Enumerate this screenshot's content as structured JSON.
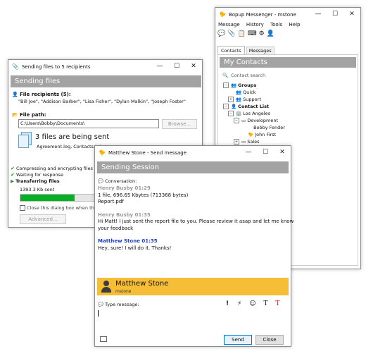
{
  "sending_window": {
    "title": "Sending files to 5 recipients",
    "banner": "Sending files",
    "recipients_label": "File recipients (5):",
    "recipients_list": "\"Bill Joe\", \"Addison Barber\", \"Lisa Fisher\", \"Dylan Malkin\", \"Joseph Foster\"",
    "file_path_label": "File path:",
    "file_path_value": "C:\\Users\\Bobby\\Documents\\",
    "browse_label": "Browse...",
    "files_sending_title": "3 files are being sent",
    "files_list": "Agreement.log, Contacts.txt,",
    "steps": [
      {
        "label": "Compressing and encrypting files"
      },
      {
        "label": "Waiting for response"
      },
      {
        "label": "Transferring files"
      }
    ],
    "progress_text": "1393.3 Kb sent",
    "progress_fraction": 0.62,
    "close_checkbox_label": "Close this dialog box when the tran",
    "advanced_label": "Advanced..."
  },
  "messenger_window": {
    "title": "Bopup Messenger - mstone",
    "menu": [
      "Message",
      "History",
      "Tools",
      "Help"
    ],
    "tabs": [
      "Contacts",
      "Messages"
    ],
    "banner": "My Contacts",
    "search_placeholder": "Contact search",
    "tree": {
      "groups": "Groups",
      "quick": "Quick",
      "support": "Support",
      "contact_list": "Contact List",
      "los_angeles": "Los Angeles",
      "development": "Development",
      "bobby_fender": "Bobby Fender",
      "john_first": "John First",
      "sales": "Sales"
    }
  },
  "send_window": {
    "title": "Matthew Stone - Send message",
    "banner": "Sending Session",
    "conversation_label": "Conversation:",
    "messages": [
      {
        "header": "Henry Busby 01:29",
        "lines": [
          "1 file, 696.65 Kbytes (713368 bytes)",
          "Report.pdf"
        ],
        "color": "#9a9a9a"
      },
      {
        "header": "Henry Busby 01:35",
        "lines": [
          "Hi Matt! I just sent the report file to you. Please review it asap and let me know",
          "your feedback"
        ],
        "color": "#9a9a9a"
      },
      {
        "header": "Matthew Stone 01:35",
        "lines": [
          "Hey, sure! I will do it. Thanks!"
        ],
        "color": "#1a3fbf"
      }
    ],
    "recipient_name": "Matthew Stone",
    "recipient_login": "mstone",
    "type_message_label": "Type message:",
    "send_label": "Send",
    "close_label": "Close"
  },
  "colors": {
    "banner_gray": "#a3a3a3",
    "progress_green": "#06b025",
    "recipient_bar": "#f6be36",
    "self_name_blue": "#1a3fbf"
  }
}
